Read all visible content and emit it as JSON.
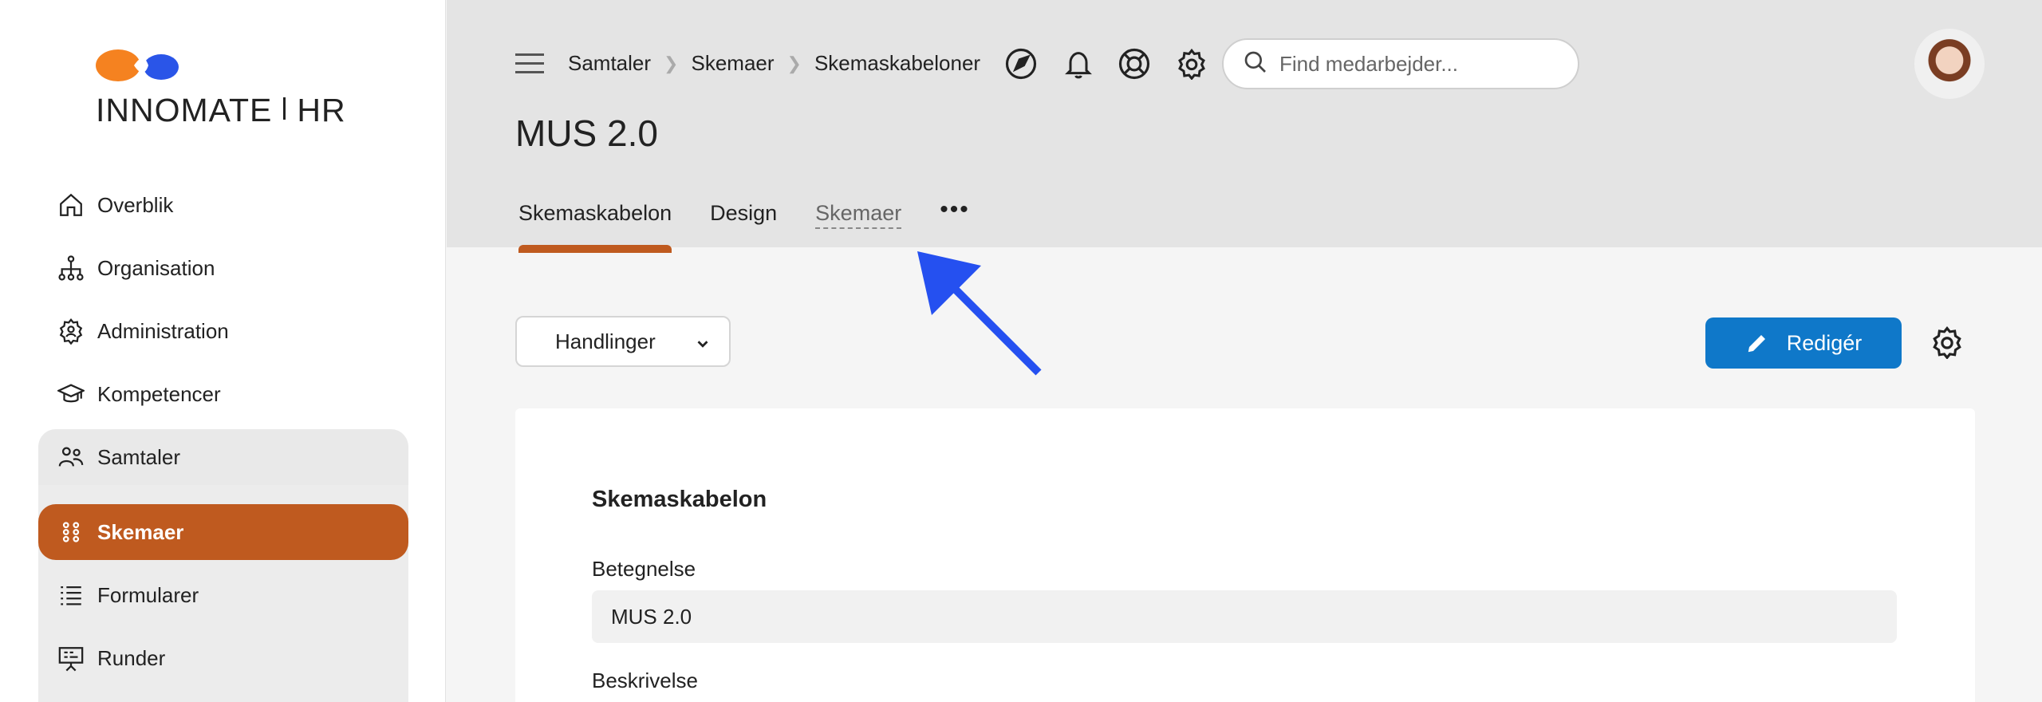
{
  "logo": {
    "text_left": "INNOMATE",
    "text_right": "HR"
  },
  "sidebar": {
    "items": [
      {
        "label": "Overblik",
        "icon": "home-icon"
      },
      {
        "label": "Organisation",
        "icon": "org-chart-icon"
      },
      {
        "label": "Administration",
        "icon": "gear-user-icon"
      },
      {
        "label": "Kompetencer",
        "icon": "graduation-cap-icon"
      },
      {
        "label": "Samtaler",
        "icon": "people-icon"
      },
      {
        "label": "Skemaer",
        "icon": "dots-grid-icon"
      },
      {
        "label": "Formularer",
        "icon": "list-icon"
      },
      {
        "label": "Runder",
        "icon": "presentation-icon"
      }
    ],
    "active_color": "#bf5a1f"
  },
  "header": {
    "breadcrumb": [
      "Samtaler",
      "Skemaer",
      "Skemaskabeloner"
    ],
    "search": {
      "placeholder": "Find medarbejder..."
    },
    "icons": [
      "navigation-icon",
      "bell-icon",
      "lifebuoy-icon",
      "gear-icon"
    ],
    "page_title": "MUS 2.0",
    "tabs": [
      {
        "label": "Skemaskabelon",
        "active": true
      },
      {
        "label": "Design"
      },
      {
        "label": "Skemaer"
      }
    ],
    "more_label": "•••"
  },
  "toolbar": {
    "actions_label": "Handlinger",
    "edit_label": "Redigér",
    "edit_color": "#0f78c9"
  },
  "card": {
    "title": "Skemaskabelon",
    "fields": [
      {
        "label": "Betegnelse",
        "value": "MUS 2.0"
      },
      {
        "label": "Beskrivelse"
      }
    ]
  },
  "annotation": {
    "arrow_color": "#2550f0"
  }
}
